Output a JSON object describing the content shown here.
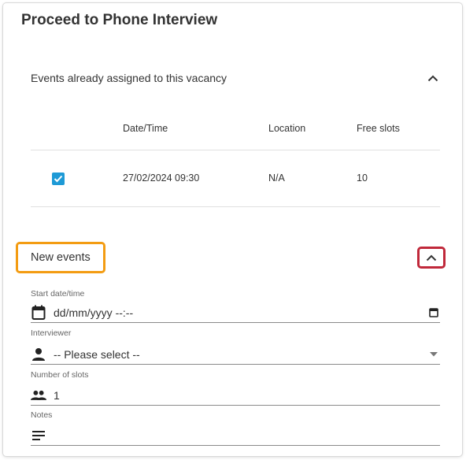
{
  "dialog": {
    "title": "Proceed to Phone Interview"
  },
  "assigned_section": {
    "label": "Events already assigned to this vacancy",
    "columns": [
      "Date/Time",
      "Location",
      "Free slots"
    ],
    "rows": [
      {
        "checked": true,
        "datetime": "27/02/2024 09:30",
        "location": "N/A",
        "free_slots": "10"
      }
    ]
  },
  "new_events_section": {
    "label": "New events"
  },
  "fields": {
    "start": {
      "label": "Start date/time",
      "value": "dd/mm/yyyy --:--",
      "icon": "calendar-icon"
    },
    "interviewer": {
      "label": "Interviewer",
      "value": "-- Please select --",
      "icon": "person-icon"
    },
    "slots": {
      "label": "Number of slots",
      "value": "1",
      "icon": "people-icon"
    },
    "notes": {
      "label": "Notes",
      "value": "",
      "icon": "notes-icon"
    }
  },
  "colors": {
    "accent": "#1e9ad6",
    "highlight_orange": "#f39c12",
    "highlight_red": "#c0283a"
  }
}
